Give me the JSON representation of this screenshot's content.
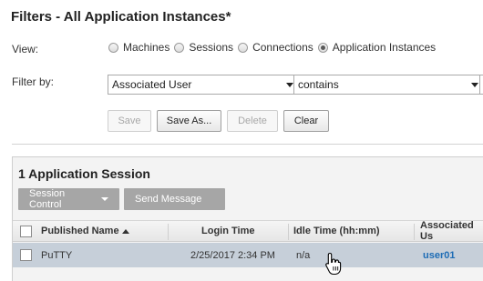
{
  "header": {
    "title": "Filters - All Application Instances*"
  },
  "view": {
    "label": "View:",
    "options": [
      "Machines",
      "Sessions",
      "Connections",
      "Application Instances"
    ],
    "selected_index": 3
  },
  "filter": {
    "label": "Filter by:",
    "field": "Associated User",
    "operator": "contains"
  },
  "actions": {
    "save": "Save",
    "save_as": "Save As...",
    "delete": "Delete",
    "clear": "Clear"
  },
  "panel": {
    "title": "1 Application Session",
    "session_control": "Session Control",
    "send_message": "Send Message"
  },
  "table": {
    "columns": [
      "Published Name",
      "Login Time",
      "Idle Time (hh:mm)",
      "Associated Us"
    ],
    "sort_column": "Published Name",
    "sort_direction": "ascending",
    "rows": [
      {
        "published_name": "PuTTY",
        "login_time": "2/25/2017 2:34 PM",
        "idle_time": "n/a",
        "associated_user": "user01"
      }
    ]
  },
  "colors": {
    "link": "#1d6cb5",
    "selected_row": "#c6cfd9",
    "toolbar_button": "#a6a6a6"
  }
}
